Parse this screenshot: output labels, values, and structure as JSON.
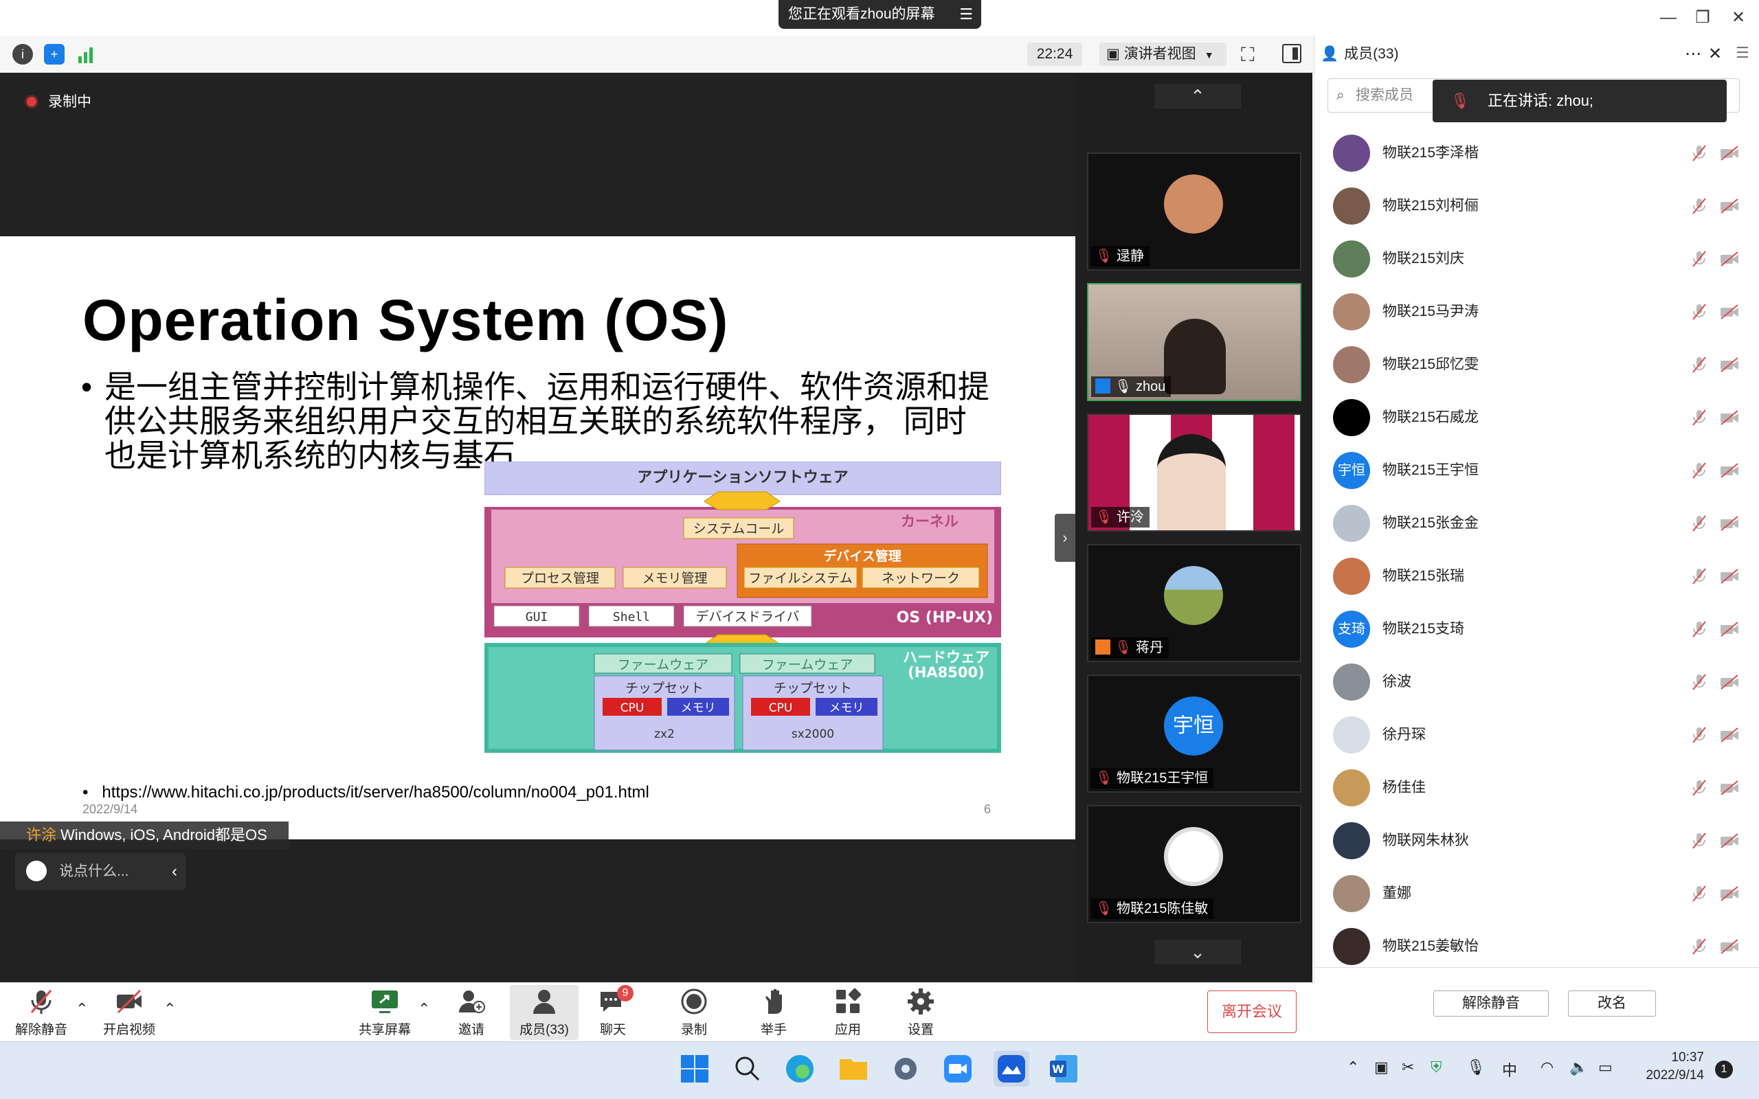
{
  "titlebar": {
    "screen_banner": "您正在观看zhou的屏幕",
    "banner_menu_icon": "menu-icon"
  },
  "toolbar": {
    "time": "22:24",
    "view_mode": "演讲者视图"
  },
  "meeting": {
    "recording_label": "录制中",
    "chat_bubble_name": "许涂",
    "chat_bubble_text": "Windows, iOS, Android都是OS",
    "say_placeholder": "说点什么..."
  },
  "slide": {
    "title": "Operation System (OS)",
    "bullet": "是一组主管并控制计算机操作、运用和运行硬件、软件资源和提供公共服务来组织用户交互的相互关联的系统软件程序， 同时也是计算机系统的内核与基石",
    "diagram": {
      "app_layer": "アプリケーションソフトウェア",
      "syscall": "システムコール",
      "kernel": "カーネル",
      "device_mgmt": "デバイス管理",
      "process_mgmt": "プロセス管理",
      "memory_mgmt": "メモリ管理",
      "filesystem": "ファイルシステム",
      "network": "ネットワーク",
      "gui": "GUI",
      "shell": "Shell",
      "device_driver": "デバイスドライバ",
      "os_label": "OS (HP-UX)",
      "firmware1": "ファームウェア",
      "firmware2": "ファームウェア",
      "hardware_label_1": "ハードウェア",
      "hardware_label_2": "(HA8500)",
      "chipset1": "チップセット",
      "chipset2": "チップセット",
      "cpu1": "CPU",
      "cpu2": "CPU",
      "mem1": "メモリ",
      "mem2": "メモリ",
      "chip1_name": "zx2",
      "chip2_name": "sx2000"
    },
    "link": "https://www.hitachi.co.jp/products/it/server/ha8500/column/no004_p01.html",
    "date": "2022/9/14",
    "page": "6"
  },
  "video_tiles": [
    {
      "name": "逯静"
    },
    {
      "name": "zhou"
    },
    {
      "name": "许泠"
    },
    {
      "name": "蒋丹"
    },
    {
      "name": "物联215王宇恒",
      "avatar_text": "宇恒"
    },
    {
      "name": "物联215陈佳敏"
    }
  ],
  "panel": {
    "title": "成员(33)",
    "search_placeholder": "搜索成员",
    "speaking": "正在讲话: zhou;",
    "members": [
      {
        "name": "物联215李泽楷",
        "color": "#6b4a8c"
      },
      {
        "name": "物联215刘柯俪",
        "color": "#7a5a4a"
      },
      {
        "name": "物联215刘庆",
        "color": "#5e7f5a"
      },
      {
        "name": "物联215马尹涛",
        "color": "#b08870"
      },
      {
        "name": "物联215邱忆雯",
        "color": "#a0786a"
      },
      {
        "name": "物联215石威龙",
        "color": "#000000"
      },
      {
        "name": "物联215王宇恒",
        "color": "#1a7ee8",
        "avatar_text": "宇恒"
      },
      {
        "name": "物联215张金金",
        "color": "#b7c2cc"
      },
      {
        "name": "物联215张瑞",
        "color": "#c8734a"
      },
      {
        "name": "物联215支琦",
        "color": "#1a7ee8",
        "avatar_text": "支琦"
      },
      {
        "name": "徐波",
        "color": "#8a8f98"
      },
      {
        "name": "徐丹琛",
        "color": "#d8dde6"
      },
      {
        "name": "杨佳佳",
        "color": "#c79a5a"
      },
      {
        "name": "物联网朱林狄",
        "color": "#2e3a4e"
      },
      {
        "name": "董娜",
        "color": "#a68a78"
      },
      {
        "name": "物联215姜敏怡",
        "color": "#3a2a2a"
      }
    ],
    "btn_unmute": "解除静音",
    "btn_rename": "改名"
  },
  "bottombar": {
    "unmute": "解除静音",
    "start_video": "开启视频",
    "share_screen": "共享屏幕",
    "invite": "邀请",
    "members": "成员(33)",
    "chat": "聊天",
    "chat_badge": "9",
    "record": "录制",
    "raise_hand": "举手",
    "apps": "应用",
    "settings": "设置",
    "leave": "离开会议"
  },
  "taskbar": {
    "ime": "中",
    "clock_time": "10:37",
    "clock_date": "2022/9/14",
    "notification_count": "1"
  }
}
